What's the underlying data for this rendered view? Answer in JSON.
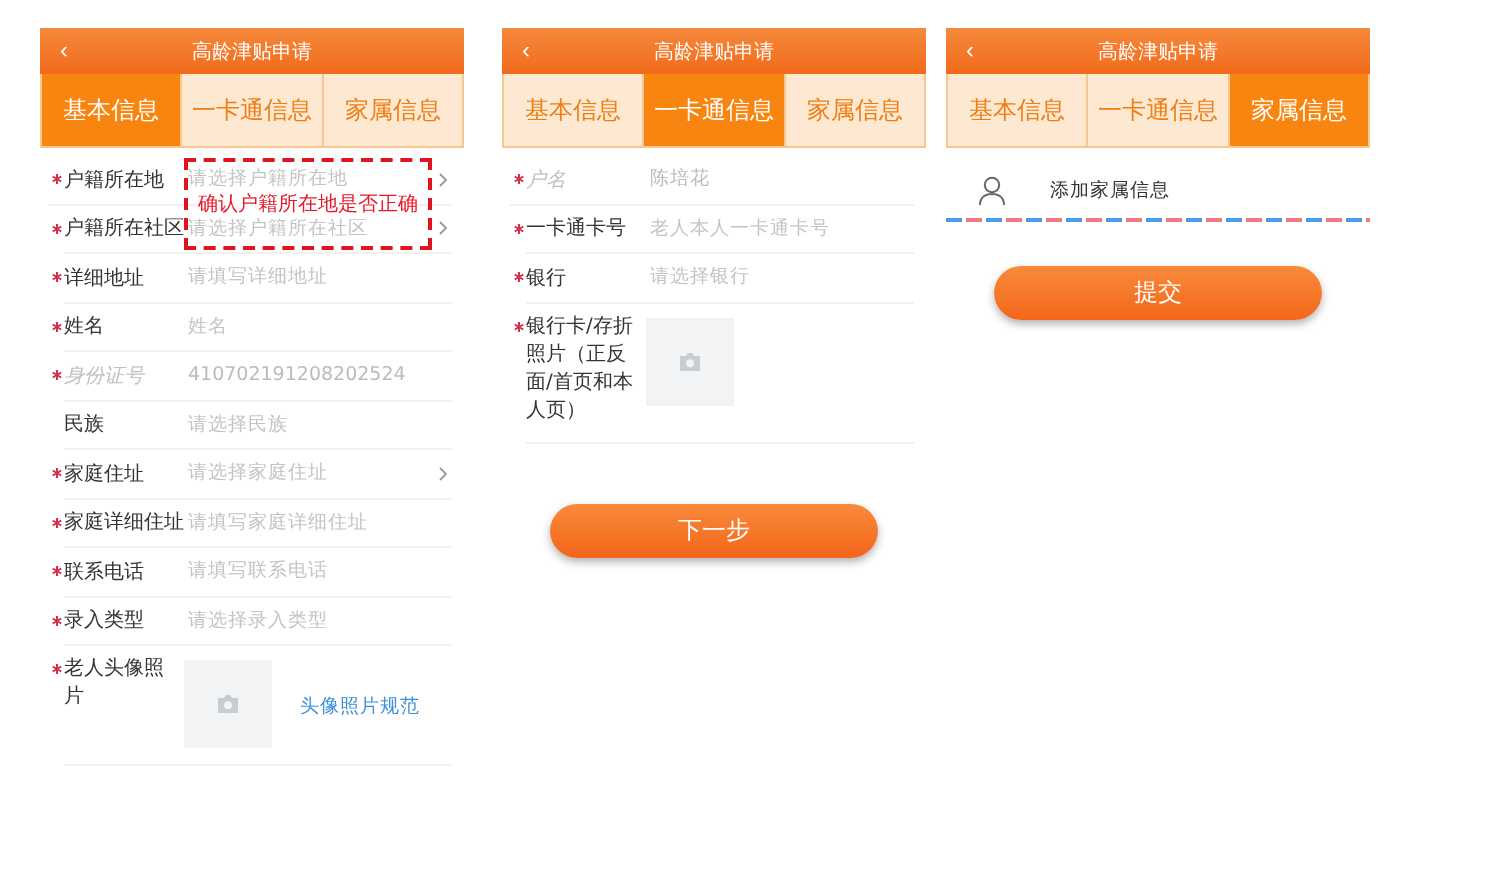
{
  "screens": [
    {
      "back": "‹",
      "title": "高龄津贴申请",
      "tabs": [
        {
          "label": "基本信息",
          "selected": true
        },
        {
          "label": "一卡通信息",
          "selected": false
        },
        {
          "label": "家属信息",
          "selected": false
        }
      ],
      "fields": [
        {
          "kind": "select",
          "label": "户籍所在地",
          "required": true,
          "disabled": false,
          "placeholder": "请选择户籍所在地"
        },
        {
          "kind": "select",
          "label": "户籍所在社区",
          "required": true,
          "disabled": false,
          "placeholder": "请选择户籍所在社区"
        },
        {
          "kind": "input",
          "label": "详细地址",
          "required": true,
          "disabled": false,
          "placeholder": "请填写详细地址"
        },
        {
          "kind": "input",
          "label": "姓名",
          "required": true,
          "disabled": false,
          "placeholder": "姓名"
        },
        {
          "kind": "input",
          "label": "身份证号",
          "required": true,
          "disabled": true,
          "value": "410702191208202524"
        },
        {
          "kind": "input",
          "label": "民族",
          "required": false,
          "disabled": false,
          "placeholder": "请选择民族"
        },
        {
          "kind": "select",
          "label": "家庭住址",
          "required": true,
          "disabled": false,
          "placeholder": "请选择家庭住址"
        },
        {
          "kind": "input",
          "label": "家庭详细住址",
          "required": true,
          "disabled": false,
          "placeholder": "请填写家庭详细住址"
        },
        {
          "kind": "input",
          "label": "联系电话",
          "required": true,
          "disabled": false,
          "placeholder": "请填写联系电话"
        },
        {
          "kind": "input",
          "label": "录入类型",
          "required": true,
          "disabled": false,
          "placeholder": "请选择录入类型"
        },
        {
          "kind": "photo",
          "label": "老人头像照片",
          "required": true,
          "disabled": false,
          "link": "头像照片规范"
        }
      ],
      "annotation": "确认户籍所在地是否正确"
    },
    {
      "back": "‹",
      "title": "高龄津贴申请",
      "tabs": [
        {
          "label": "基本信息",
          "selected": false
        },
        {
          "label": "一卡通信息",
          "selected": true
        },
        {
          "label": "家属信息",
          "selected": false
        }
      ],
      "fields": [
        {
          "kind": "input",
          "label": "户名",
          "required": true,
          "disabled": true,
          "value": "陈培花"
        },
        {
          "kind": "input",
          "label": "一卡通卡号",
          "required": true,
          "disabled": false,
          "placeholder": "老人本人一卡通卡号"
        },
        {
          "kind": "input",
          "label": "银行",
          "required": true,
          "disabled": false,
          "placeholder": "请选择银行"
        },
        {
          "kind": "photo",
          "label": "银行卡/存折照片（正反面/首页和本人页）",
          "required": true,
          "disabled": false
        }
      ],
      "button": "下一步"
    },
    {
      "back": "‹",
      "title": "高龄津贴申请",
      "tabs": [
        {
          "label": "基本信息",
          "selected": false
        },
        {
          "label": "一卡通信息",
          "selected": false
        },
        {
          "label": "家属信息",
          "selected": true
        }
      ],
      "family": "添加家属信息",
      "button": "提交"
    }
  ]
}
